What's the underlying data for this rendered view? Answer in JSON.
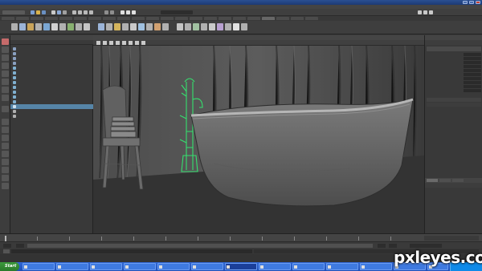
{
  "window": {
    "title": ""
  },
  "taskbar": {
    "start_label": "Start",
    "tasks": [
      "",
      "",
      "",
      "",
      "",
      "",
      "",
      "",
      "",
      "",
      "",
      "",
      ""
    ]
  },
  "watermark": "pxleyes.com",
  "viewport": {
    "hud": {
      "rows": [
        [
          "",
          "",
          "",
          ""
        ],
        [
          "",
          "",
          "",
          ""
        ],
        [
          "",
          "",
          "",
          ""
        ],
        [
          "",
          "",
          "",
          ""
        ],
        [
          "",
          "",
          "",
          ""
        ]
      ]
    }
  },
  "outliner": {
    "rows": [
      "",
      "",
      "",
      "",
      "",
      "",
      "",
      "",
      "",
      "",
      "",
      "",
      "",
      "",
      ""
    ],
    "selected_index": 11
  },
  "channels": {
    "rows": [
      "",
      "",
      "",
      "",
      "",
      "",
      "",
      "",
      "",
      ""
    ],
    "values": [
      "",
      "",
      "",
      "",
      "",
      "",
      "",
      "",
      "",
      ""
    ]
  },
  "colors": {
    "accent_green": "#35e06e",
    "selection": "#5685a8",
    "taskbar": "#2459c8"
  }
}
